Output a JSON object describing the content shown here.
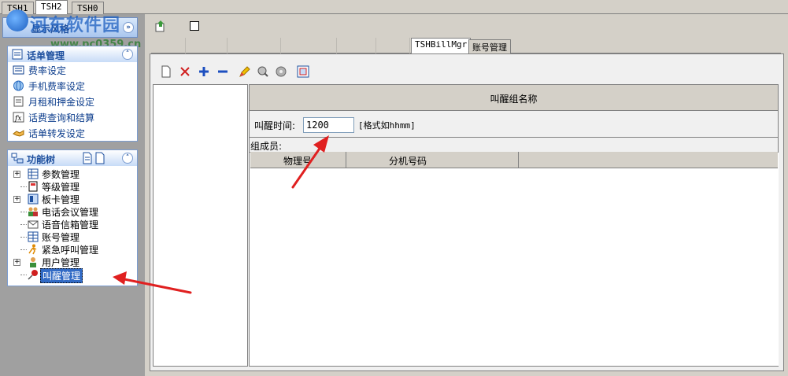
{
  "top_tabs": [
    "TSH1",
    "TSH2",
    "TSH0"
  ],
  "watermark": {
    "title": "河东软件园",
    "url": "www.pc0359.cn"
  },
  "left": {
    "header_partial": "显示风格",
    "bill_panel": {
      "title": "话单管理",
      "items": [
        "费率设定",
        "手机费率设定",
        "月租和押金设定",
        "话费查询和结算",
        "话单转发设定"
      ]
    },
    "tree_panel": {
      "title": "功能树",
      "items": [
        {
          "label": "参数管理",
          "expandable": true
        },
        {
          "label": "等级管理",
          "expandable": false
        },
        {
          "label": "板卡管理",
          "expandable": true
        },
        {
          "label": "电话会议管理",
          "expandable": false
        },
        {
          "label": "语音信箱管理",
          "expandable": false
        },
        {
          "label": "账号管理",
          "expandable": false
        },
        {
          "label": "紧急呼叫管理",
          "expandable": false
        },
        {
          "label": "用户管理",
          "expandable": true
        },
        {
          "label": "叫醒管理",
          "expandable": false,
          "selected": true
        }
      ]
    }
  },
  "tabs": {
    "active": "TSHBillMgr",
    "other": "账号管理"
  },
  "form": {
    "group_name_header": "叫醒组名称",
    "time_label": "叫醒时间:",
    "time_value": "1200",
    "time_hint": "[格式如hhmm]",
    "members_label": "组成员:",
    "columns": [
      "物理号",
      "分机号码"
    ]
  },
  "colors": {
    "accent": "#316ac5",
    "arrow": "#e02020",
    "panel_bg": "#a0a0a0"
  }
}
